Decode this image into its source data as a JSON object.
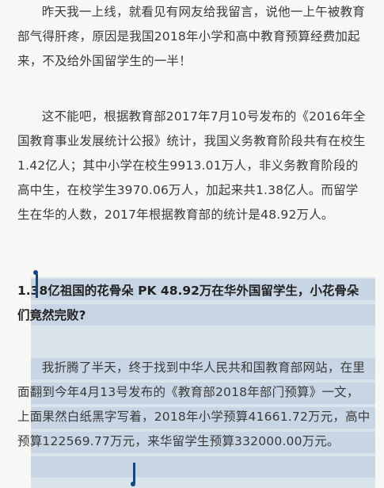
{
  "article": {
    "p1": "      昨天我一上线，就看见有网友给我留言，说他一上午被教育部气得肝疼，原因是我国2018年小学和高中教育预算经费加起来，不及给外国留学生的一半！",
    "p2": "      这不能吧，根据教育部2017年7月10号发布的《2016年全国教育事业发展统计公报》统计，我国义务教育阶段共有在校生1.42亿人；其中小学在校生9913.01万人，非义务教育阶段的高中生，在校学生3970.06万人，加起来共1.38亿人。而留学生在华的人数，2017年根据教育部的统计是48.92万人。",
    "heading": "1.38亿祖国的花骨朵 PK 48.92万在华外国留学生，小花骨朵们竟然完败?",
    "p3": "      我折腾了半天，终于找到中华人民共和国教育部网站，在里面翻到今年4月13号发布的《教育部2018年部门预算》一文，上面果然白纸黑字写着，2018年小学预算41661.72万元，高中预算122569.77万元，来华留学生预算332000.00万元。"
  },
  "colors": {
    "selection": "#d9e3ec",
    "handle": "#17477a"
  }
}
